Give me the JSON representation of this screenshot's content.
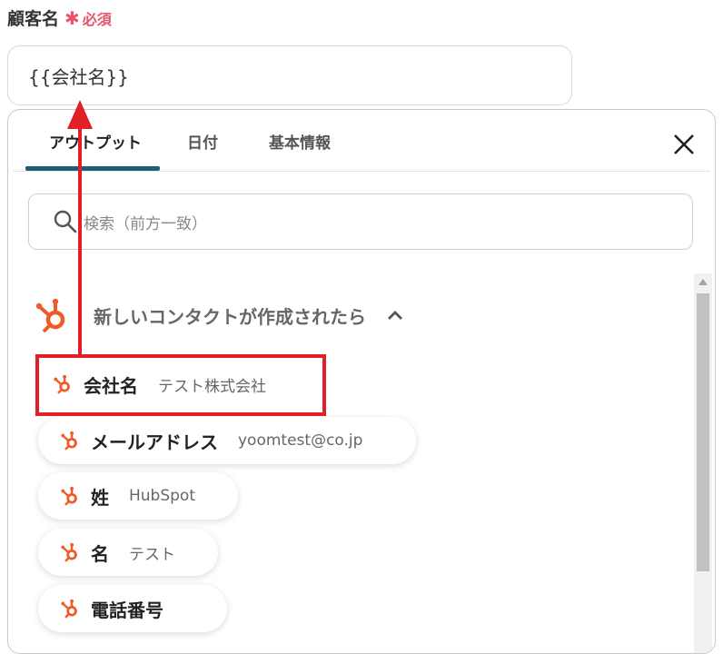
{
  "field": {
    "label": "顧客名",
    "required_star": "✱",
    "required_text": "必須",
    "value": "{{会社名}}"
  },
  "tabs": [
    {
      "label": "アウトプット",
      "active": true
    },
    {
      "label": "日付",
      "active": false
    },
    {
      "label": "基本情報",
      "active": false
    }
  ],
  "search": {
    "placeholder": "検索（前方一致）"
  },
  "group": {
    "title": "新しいコンタクトが作成されたら",
    "expanded": true
  },
  "items": [
    {
      "name": "会社名",
      "value": "テスト株式会社"
    },
    {
      "name": "メールアドレス",
      "value": "yoomtest@co.jp"
    },
    {
      "name": "姓",
      "value": "HubSpot"
    },
    {
      "name": "名",
      "value": "テスト"
    },
    {
      "name": "電話番号",
      "value": ""
    }
  ],
  "colors": {
    "accent": "#1f5f76",
    "hubspot": "#f05a28",
    "required": "#e8526a",
    "annotation": "#e01f26"
  }
}
